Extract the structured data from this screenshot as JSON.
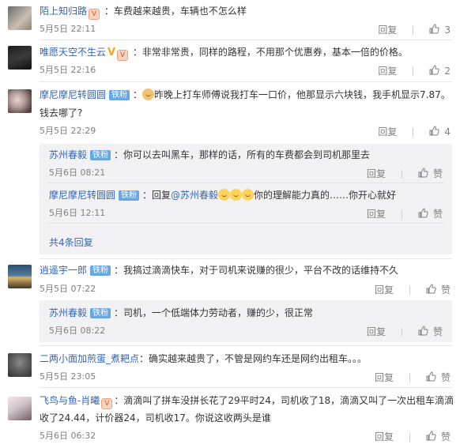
{
  "comments": [
    {
      "user": "陌上知归路",
      "text": "：车费越来越贵，车辆也不怎么样",
      "time": "5月5日 22:11",
      "reply_label": "回复",
      "likes": "3"
    },
    {
      "user": "唯愿天空不生云",
      "text": "：非常非常贵，同样的路程，不用那个优惠券，基本一倍的价格。",
      "time": "5月5日 22:16",
      "reply_label": "回复",
      "likes": "2"
    },
    {
      "user": "摩尼摩尼转圆圆",
      "badge": "铁粉",
      "text_line1": "昨晚上打车师傅说我打车一口价，他那显示六块钱，我手机显示7.87。",
      "text_line2": "钱去哪了?",
      "time": "5月5日 22:29",
      "reply_label": "回复",
      "likes": "4",
      "replies": [
        {
          "user": "苏州春毅",
          "badge": "铁粉",
          "text": "：你可以去叫黑车，那样的话，所有的车费都会到司机那里去",
          "time": "5月6日 08:21",
          "reply_label": "回复",
          "like_label": "赞"
        },
        {
          "user": "摩尼摩尼转圆圆",
          "badge": "铁粉",
          "prefix": "：回复",
          "at": "@苏州春毅",
          "text": "你的理解能力真的……你开心就好",
          "time": "5月6日 12:11",
          "reply_label": "回复",
          "like_label": "赞"
        }
      ],
      "more_replies": "共4条回复"
    },
    {
      "user": "逍遥宇一郎",
      "badge": "铁粉",
      "text": "：我搞过滴滴快车，对于司机来说赚的很少，平台不改的话维持不久",
      "time": "5月5日 07:22",
      "reply_label": "回复",
      "like_label": "赞",
      "replies": [
        {
          "user": "苏州春毅",
          "badge": "铁粉",
          "text": "：司机，一个低端体力劳动者，赚的少，很正常",
          "time": "5月6日 08:22",
          "reply_label": "回复",
          "like_label": "赞"
        }
      ]
    },
    {
      "user": "二两小面加煎蛋_煮耙点",
      "text": "：确实越来越贵了，不管是网约车还是网约出租车。。。",
      "time": "5月5日 23:05",
      "reply_label": "回复",
      "like_label": "赞"
    },
    {
      "user": "飞鸟与鱼-肖曦",
      "text_line1": "：滴滴叫了拼车没拼长花了29平时24，司机收了18，滴滴又叫了一次出租车滴滴",
      "text_line2": "收了24.44，计价器24，司机收17。你说这收两头是谁",
      "time": "5月6日 06:32",
      "reply_label": "回复",
      "like_label": "赞"
    }
  ]
}
